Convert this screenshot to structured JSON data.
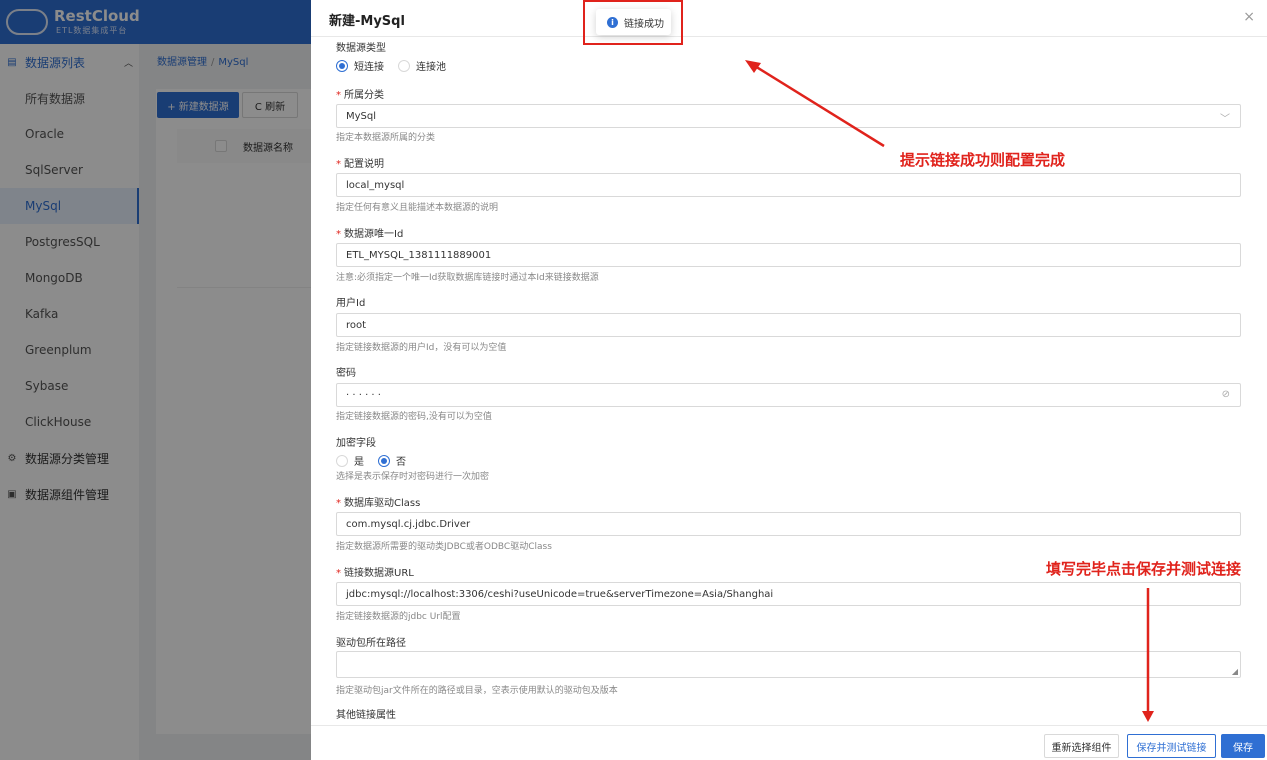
{
  "brand": {
    "name": "RestCloud",
    "subtitle": "ETL数据集成平台"
  },
  "sidebar": {
    "group_datasource": "数据源列表",
    "items": [
      {
        "label": "所有数据源",
        "active": false
      },
      {
        "label": "Oracle",
        "active": false
      },
      {
        "label": "SqlServer",
        "active": false
      },
      {
        "label": "MySql",
        "active": true
      },
      {
        "label": "PostgresSQL",
        "active": false
      },
      {
        "label": "MongoDB",
        "active": false
      },
      {
        "label": "Kafka",
        "active": false
      },
      {
        "label": "Greenplum",
        "active": false
      },
      {
        "label": "Sybase",
        "active": false
      },
      {
        "label": "ClickHouse",
        "active": false
      }
    ],
    "group_category": "数据源分类管理",
    "group_component": "数据源组件管理"
  },
  "main": {
    "breadcrumb": {
      "root": "数据源管理",
      "sep": "/",
      "current": "MySql"
    },
    "new_button": "+ 新建数据源",
    "refresh_button": "C 刷新",
    "col_name": "数据源名称"
  },
  "drawer": {
    "title": "新建-MySql",
    "close": "×",
    "toast": "链接成功",
    "form": {
      "type_label": "数据源类型",
      "type_options": [
        "短连接",
        "连接池"
      ],
      "type_selected": "短连接",
      "category_label": "所属分类",
      "category_value": "MySql",
      "category_hint": "指定本数据源所属的分类",
      "desc_label": "配置说明",
      "desc_value": "local_mysql",
      "desc_hint": "指定任何有意义且能描述本数据源的说明",
      "id_label": "数据源唯一Id",
      "id_value": "ETL_MYSQL_1381111889001",
      "id_hint": "注意:必须指定一个唯一Id获取数据库链接时通过本Id来链接数据源",
      "user_label": "用户Id",
      "user_value": "root",
      "user_hint": "指定链接数据源的用户Id，没有可以为空值",
      "pwd_label": "密码",
      "pwd_value": "· · · · · ·",
      "pwd_hint": "指定链接数据源的密码,没有可以为空值",
      "encrypt_label": "加密字段",
      "encrypt_options": [
        "是",
        "否"
      ],
      "encrypt_selected": "否",
      "encrypt_hint": "选择是表示保存时对密码进行一次加密",
      "driver_label": "数据库驱动Class",
      "driver_value": "com.mysql.cj.jdbc.Driver",
      "driver_hint": "指定数据源所需要的驱动类JDBC或者ODBC驱动Class",
      "url_label": "链接数据源URL",
      "url_value": "jdbc:mysql://localhost:3306/ceshi?useUnicode=true&serverTimezone=Asia/Shanghai",
      "url_hint": "指定链接数据源的jdbc Url配置",
      "jar_label": "驱动包所在路径",
      "jar_value": "",
      "jar_hint": "指定驱动包jar文件所在的路径或目录，空表示使用默认的驱动包及版本",
      "other_label": "其他链接属性"
    },
    "footer": {
      "reselect": "重新选择组件",
      "save_test": "保存并测试链接",
      "save": "保存"
    }
  },
  "annotations": {
    "success_note": "提示链接成功则配置完成",
    "fill_note": "填写完毕点击保存并测试连接"
  },
  "colors": {
    "primary": "#2f6fd3",
    "annotation": "#e0231c",
    "required": "#e0231c"
  }
}
